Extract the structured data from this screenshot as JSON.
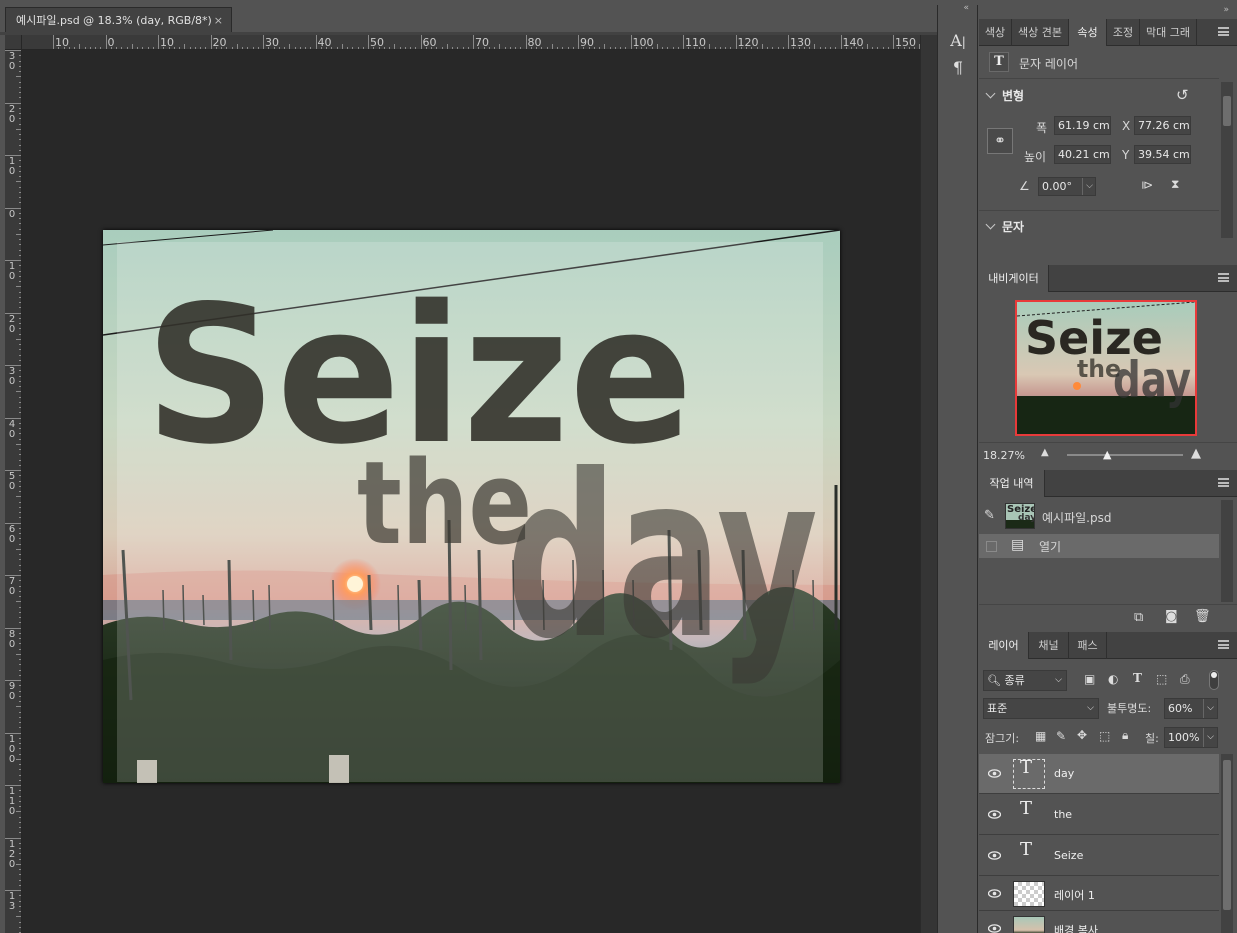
{
  "document": {
    "tab_title": "예시파일.psd @ 18.3% (day, RGB/8*)",
    "close_glyph": "×"
  },
  "rulers": {
    "top_labels": [
      "10",
      "0",
      "10",
      "20",
      "30",
      "40",
      "50",
      "60",
      "70",
      "80",
      "90",
      "100",
      "110",
      "120",
      "130",
      "140",
      "150"
    ],
    "left_labels": [
      "3\n0",
      "2\n0",
      "1\n0",
      "0",
      "1\n0",
      "2\n0",
      "3\n0",
      "4\n0",
      "5\n0",
      "6\n0",
      "7\n0",
      "8\n0",
      "9\n0",
      "1\n0\n0",
      "1\n1\n0",
      "1\n2\n0",
      "1\n3"
    ]
  },
  "artwork": {
    "line1": "Seize",
    "line2a": "the",
    "line2b": "day"
  },
  "mini_toolbar": {
    "collapse": "«",
    "char_icon": "character-panel-icon",
    "para_icon": "paragraph-panel-icon"
  },
  "properties_panel": {
    "collapse": "»",
    "tabs": [
      "색상",
      "색상 견본",
      "속성",
      "조정",
      "막대 그래"
    ],
    "active_tab": "속성",
    "layer_kind": "문자 레이어",
    "transform": {
      "title": "변형",
      "width_label": "폭",
      "width_value": "61.19 cm",
      "height_label": "높이",
      "height_value": "40.21 cm",
      "x_label": "X",
      "x_value": "77.26 cm",
      "y_label": "Y",
      "y_value": "39.54 cm",
      "angle_value": "0.00°"
    },
    "text_section": "문자"
  },
  "navigator": {
    "tab": "내비게이터",
    "zoom": "18.27%",
    "thumb_line1": "Seize",
    "thumb_the": "the",
    "thumb_day": "day"
  },
  "history": {
    "tab": "작업 내역",
    "snapshot_label": "예시파일.psd",
    "snapshot_thumb_a": "Seize",
    "snapshot_thumb_b": "day",
    "step_label": "열기"
  },
  "layers_panel": {
    "tabs": [
      "레이어",
      "채널",
      "패스"
    ],
    "filter_label": "종류",
    "blend_mode": "표준",
    "opacity_label": "불투명도:",
    "opacity_value": "60%",
    "lock_label": "잠그기:",
    "fill_label": "칠:",
    "fill_value": "100%",
    "layers": [
      {
        "name": "day",
        "kind": "text",
        "selected": true
      },
      {
        "name": "the",
        "kind": "text",
        "selected": false
      },
      {
        "name": "Seize",
        "kind": "text",
        "selected": false
      },
      {
        "name": "레이어 1",
        "kind": "pixel",
        "selected": false
      },
      {
        "name": "배경 복사",
        "kind": "image",
        "selected": false
      }
    ]
  },
  "colors": {
    "panel_bg": "#535353",
    "canvas_bg": "#282828",
    "nav_frame": "#e83a3a"
  }
}
